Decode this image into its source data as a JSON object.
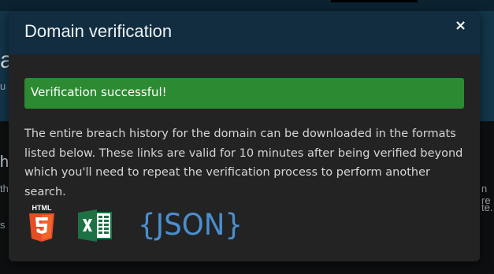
{
  "modal": {
    "title": "Domain verification",
    "close_label": "×",
    "alert_text": "Verification successful!",
    "description": "The entire breach history for the domain can be downloaded in the formats listed below. These links are valid for 10 minutes after being verified beyond which you'll need to repeat the verification process to perform another search.",
    "formats": [
      {
        "name": "HTML5",
        "label": "HTML",
        "icon": "html5-icon"
      },
      {
        "name": "Excel",
        "icon": "excel-icon"
      },
      {
        "name": "JSON",
        "label": "{JSON}",
        "icon": "json-icon"
      }
    ]
  },
  "background": {
    "hero_title_fragment": "a",
    "hero_sub_fragment": "u",
    "section_title_fragment": "h",
    "line1_left": "th",
    "line2_left": "s i",
    "line1_right": "n re",
    "line2_right": "te."
  },
  "colors": {
    "header": "#122d3f",
    "modal_body": "#232323",
    "alert": "#2c8a32",
    "html5": "#e44d26",
    "excel": "#1e7145",
    "json": "#4a8fd0"
  }
}
